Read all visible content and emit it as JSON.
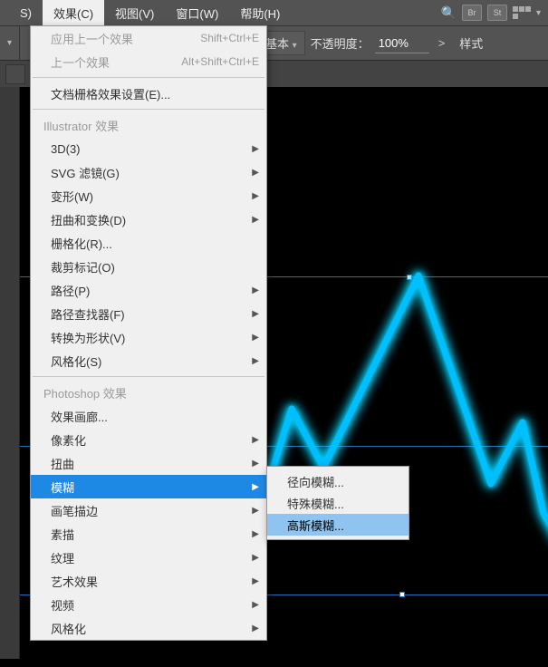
{
  "menubar": {
    "items": [
      {
        "label": "S)"
      },
      {
        "label": "效果(C)"
      },
      {
        "label": "视图(V)"
      },
      {
        "label": "窗口(W)"
      },
      {
        "label": "帮助(H)"
      }
    ],
    "icons": {
      "br": "Br",
      "st": "St"
    }
  },
  "toolbar": {
    "basic": "基本",
    "opacity_label": "不透明度：",
    "opacity_value": "100%",
    "style_label": "样式"
  },
  "dropdown": {
    "apply_last": {
      "label": "应用上一个效果",
      "shortcut": "Shift+Ctrl+E"
    },
    "last_effect": {
      "label": "上一个效果",
      "shortcut": "Alt+Shift+Ctrl+E"
    },
    "raster_settings": "文档栅格效果设置(E)...",
    "illustrator_header": "Illustrator 效果",
    "ai_items": [
      {
        "label": "3D(3)",
        "arrow": true
      },
      {
        "label": "SVG 滤镜(G)",
        "arrow": true
      },
      {
        "label": "变形(W)",
        "arrow": true
      },
      {
        "label": "扭曲和变换(D)",
        "arrow": true
      },
      {
        "label": "栅格化(R)...",
        "arrow": false
      },
      {
        "label": "裁剪标记(O)",
        "arrow": false
      },
      {
        "label": "路径(P)",
        "arrow": true
      },
      {
        "label": "路径查找器(F)",
        "arrow": true
      },
      {
        "label": "转换为形状(V)",
        "arrow": true
      },
      {
        "label": "风格化(S)",
        "arrow": true
      }
    ],
    "photoshop_header": "Photoshop 效果",
    "ps_items": [
      {
        "label": "效果画廊...",
        "arrow": false
      },
      {
        "label": "像素化",
        "arrow": true
      },
      {
        "label": "扭曲",
        "arrow": true
      },
      {
        "label": "模糊",
        "arrow": true,
        "highlighted": true
      },
      {
        "label": "画笔描边",
        "arrow": true
      },
      {
        "label": "素描",
        "arrow": true
      },
      {
        "label": "纹理",
        "arrow": true
      },
      {
        "label": "艺术效果",
        "arrow": true
      },
      {
        "label": "视频",
        "arrow": true
      },
      {
        "label": "风格化",
        "arrow": true
      }
    ]
  },
  "submenu": {
    "items": [
      {
        "label": "径向模糊...",
        "highlighted": false
      },
      {
        "label": "特殊模糊...",
        "highlighted": false
      },
      {
        "label": "高斯模糊...",
        "highlighted": true
      }
    ]
  }
}
